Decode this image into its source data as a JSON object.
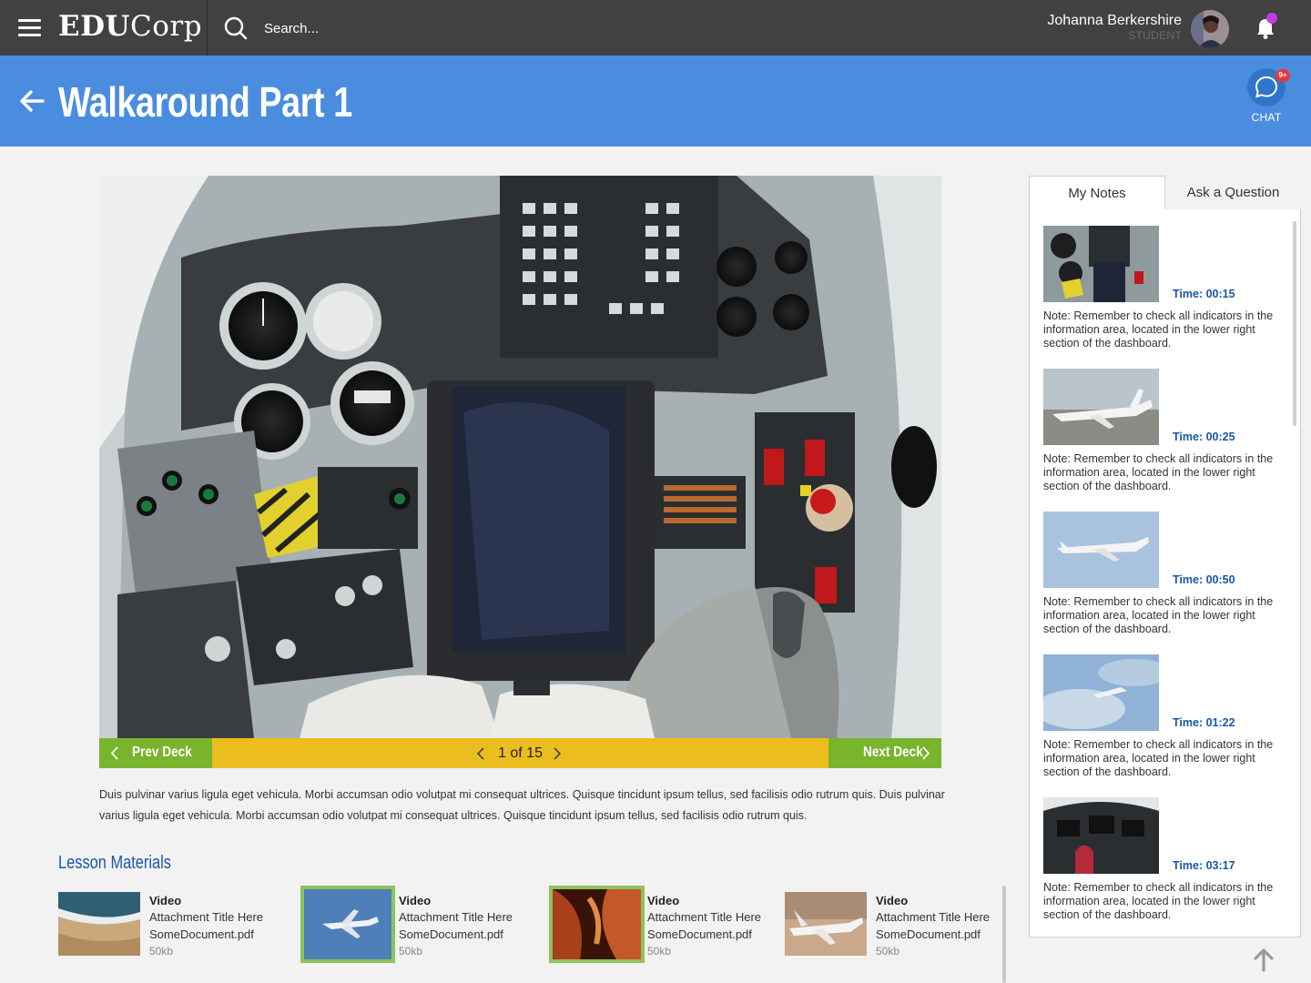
{
  "topbar": {
    "brand_bold": "EDU",
    "brand_rest": "Corp",
    "search_placeholder": "Search...",
    "user_name": "Johanna Berkershire",
    "user_role": "STUDENT"
  },
  "titlebar": {
    "title": "Walkaround Part 1",
    "chat_label": "CHAT",
    "chat_badge": "9+"
  },
  "player": {
    "prev_label": "Prev Deck",
    "next_label": "Next Deck",
    "pager_text": "1 of 15",
    "current_page": 1,
    "total_pages": 15
  },
  "description": "Duis pulvinar varius ligula eget vehicula. Morbi accumsan odio volutpat mi consequat ultrices. Quisque tincidunt ipsum tellus, sed facilisis odio rutrum quis. Duis pulvinar varius ligula eget vehicula. Morbi accumsan odio volutpat mi consequat ultrices. Quisque tincidunt ipsum tellus, sed facilisis odio rutrum quis.",
  "materials": {
    "heading": "Lesson Materials",
    "items": [
      {
        "type": "Video",
        "title": "Attachment Title Here",
        "file": "SomeDocument.pdf",
        "size": "50kb"
      },
      {
        "type": "Video",
        "title": "Attachment Title Here",
        "file": "SomeDocument.pdf",
        "size": "50kb"
      },
      {
        "type": "Video",
        "title": "Attachment Title Here",
        "file": "SomeDocument.pdf",
        "size": "50kb"
      },
      {
        "type": "Video",
        "title": "Attachment Title Here",
        "file": "SomeDocument.pdf",
        "size": "50kb"
      }
    ]
  },
  "panel": {
    "tab_notes": "My Notes",
    "tab_ask": "Ask a Question",
    "notes": [
      {
        "time": "Time: 00:15",
        "text": "Note: Remember to check all indicators in the information area, located in the lower right section of the dashboard."
      },
      {
        "time": "Time: 00:25",
        "text": "Note: Remember to check all indicators in the information area, located in the lower right section of the dashboard."
      },
      {
        "time": "Time: 00:50",
        "text": "Note: Remember to check all indicators in the information area, located in the lower right section of the dashboard."
      },
      {
        "time": "Time: 01:22",
        "text": "Note: Remember to check all indicators in the information area, located in the lower right section of the dashboard."
      },
      {
        "time": "Time: 03:17",
        "text": "Note: Remember to check all indicators in the information area, located in the lower right section of the dashboard."
      }
    ]
  },
  "colors": {
    "topbar": "#414141",
    "titlebar": "#4a8ddf",
    "accent_green": "#78b52c",
    "pager_yellow": "#ecbd1f",
    "link_blue": "#1a56a8",
    "notification_dot": "#c33de0",
    "badge_red": "#e8383d"
  }
}
